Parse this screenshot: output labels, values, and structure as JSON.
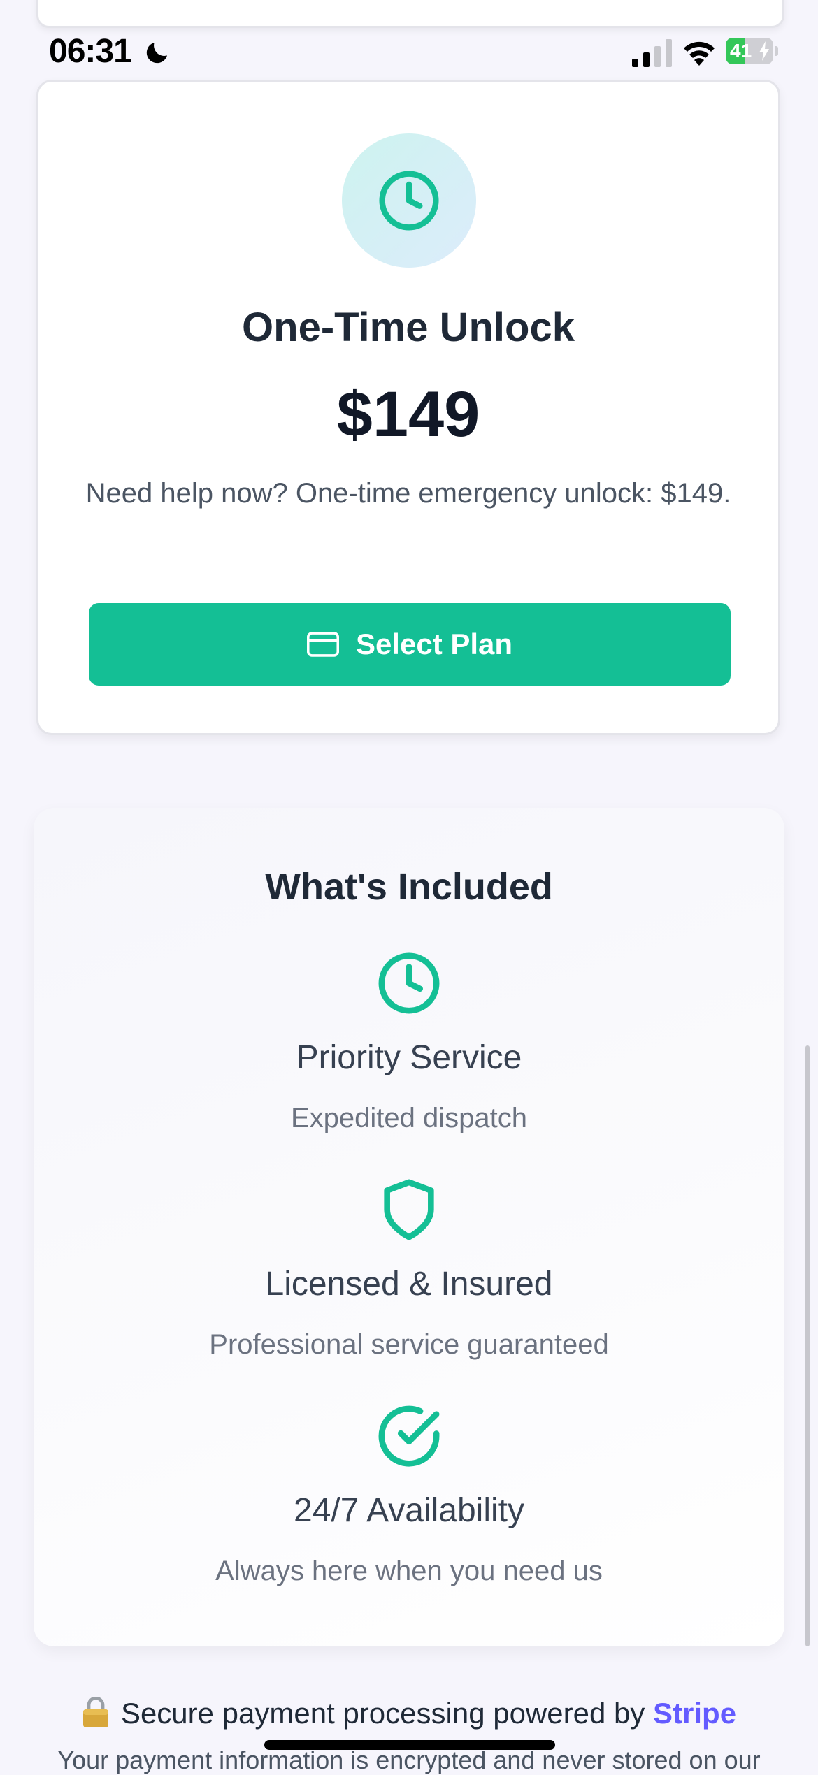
{
  "status_bar": {
    "time": "06:31",
    "battery_level": 41,
    "battery_text": "41",
    "icons": [
      "moon-icon",
      "signal-icon",
      "wifi-icon",
      "battery-icon",
      "charging-bolt-icon"
    ]
  },
  "plan": {
    "icon": "clock-icon",
    "title": "One-Time Unlock",
    "price": "$149",
    "description": "Need help now? One-time emergency unlock: $149.",
    "button_icon": "credit-card-icon",
    "button_label": "Select Plan"
  },
  "included": {
    "title": "What's Included",
    "features": [
      {
        "icon": "clock-icon",
        "title": "Priority Service",
        "description": "Expedited dispatch"
      },
      {
        "icon": "shield-icon",
        "title": "Licensed & Insured",
        "description": "Professional service guaranteed"
      },
      {
        "icon": "check-circle-icon",
        "title": "24/7 Availability",
        "description": "Always here when you need us"
      }
    ]
  },
  "footer": {
    "secure_text": "Secure payment processing powered by",
    "stripe_label": "Stripe",
    "note": "Your payment information is encrypted and never stored on our"
  },
  "colors": {
    "accent": "#14bf95",
    "stripe": "#635bff",
    "background": "#f6f5fc"
  }
}
